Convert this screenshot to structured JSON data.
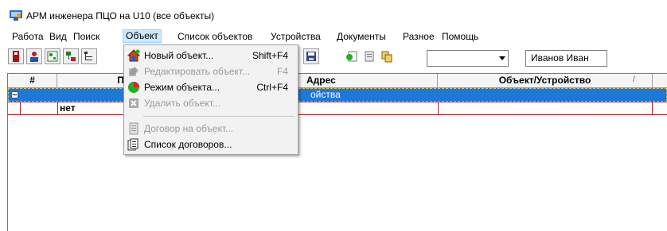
{
  "window": {
    "title": "АРМ инженера ПЦО на U10 (все объекты)"
  },
  "menubar": {
    "items": [
      {
        "label": "Работа"
      },
      {
        "label": "Вид"
      },
      {
        "label": "Поиск"
      },
      {
        "label": "Объект"
      },
      {
        "label": "Список объектов"
      },
      {
        "label": "Устройства"
      },
      {
        "label": "Документы"
      },
      {
        "label": "Разное"
      },
      {
        "label": "Помощь"
      }
    ]
  },
  "toolbar": {
    "combo_value": "",
    "user_name": "Иванов Иван"
  },
  "grid": {
    "headers": {
      "num": "#",
      "console": "Пул",
      "address": "Адрес",
      "object": "Объект/Устройство"
    },
    "rows": [
      {
        "address_partial": "ойства"
      },
      {
        "console": "нет"
      }
    ]
  },
  "object_menu": {
    "new_object": {
      "label": "Новый объект...",
      "shortcut": "Shift+F4"
    },
    "edit_object": {
      "label": "Редактировать объект...",
      "shortcut": "F4"
    },
    "object_mode": {
      "label": "Режим объекта...",
      "shortcut": "Ctrl+F4"
    },
    "delete_object": {
      "label": "Удалить объект..."
    },
    "contract_object": {
      "label": "Договор на объект..."
    },
    "contracts_list": {
      "label": "Список договоров..."
    }
  },
  "colors": {
    "selection": "#1e78d7",
    "menu_highlight": "#cce8ff",
    "row_border": "#b32020"
  }
}
